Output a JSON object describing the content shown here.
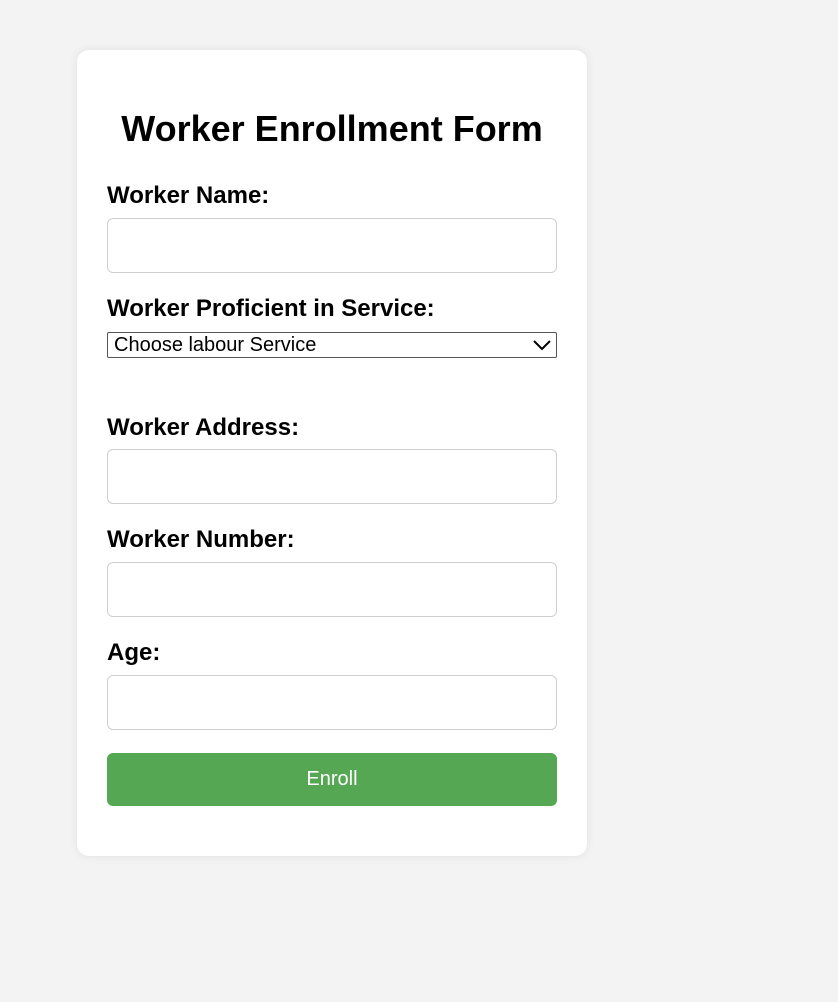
{
  "form": {
    "title": "Worker Enrollment Form",
    "fields": {
      "name": {
        "label": "Worker Name:",
        "value": ""
      },
      "service": {
        "label": "Worker Proficient in Service:",
        "selected": "Choose labour Service"
      },
      "address": {
        "label": "Worker Address:",
        "value": ""
      },
      "number": {
        "label": "Worker Number:",
        "value": ""
      },
      "age": {
        "label": "Age:",
        "value": ""
      }
    },
    "submit_label": "Enroll"
  },
  "colors": {
    "background": "#f3f3f3",
    "card": "#ffffff",
    "accent": "#55a753"
  },
  "icons": {
    "select_arrow": "chevron-down-icon"
  }
}
